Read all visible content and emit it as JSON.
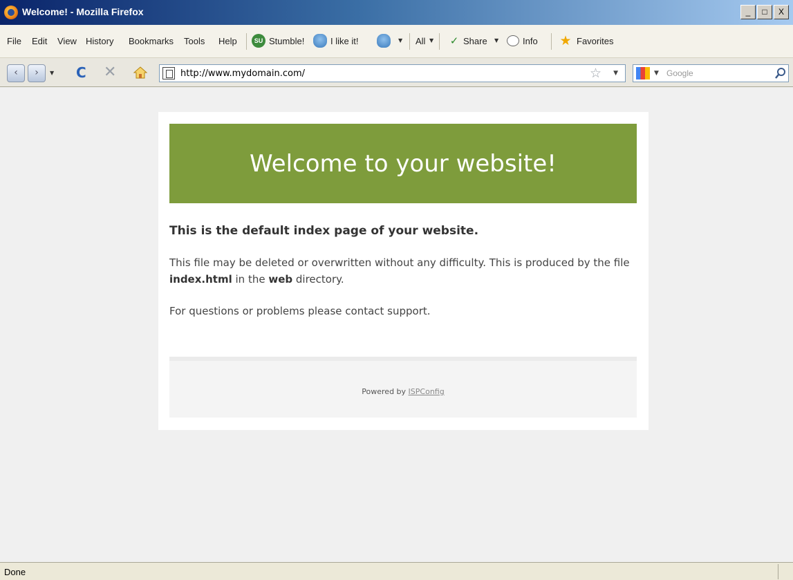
{
  "window": {
    "title": "Welcome! - Mozilla Firefox",
    "buttons": {
      "minimize": "_",
      "maximize": "□",
      "close": "X"
    }
  },
  "menu": {
    "items": [
      "File",
      "Edit",
      "View",
      "History",
      "Bookmarks",
      "Tools",
      "Help"
    ],
    "toolbar": {
      "stumble_label": "Stumble!",
      "ilike_label": "I like it!",
      "all_label": "All",
      "share_label": "Share",
      "info_label": "Info",
      "favorites_label": "Favorites"
    }
  },
  "nav": {
    "url": "http://www.mydomain.com/",
    "search_placeholder": "Google"
  },
  "page": {
    "banner_title": "Welcome to your website!",
    "heading": "This is the default index page of your website.",
    "para1_a": "This file may be deleted or overwritten without any difficulty. This is produced by the file ",
    "para1_file": "index.html",
    "para1_b": " in the ",
    "para1_dir": "web",
    "para1_c": " directory.",
    "para2": "For questions or problems please contact support.",
    "footer_powered": "Powered by ",
    "footer_link": "ISPConfig"
  },
  "status": {
    "text": "Done"
  },
  "colors": {
    "banner": "#7e9c3c",
    "page_bg": "#f0f0f0"
  }
}
